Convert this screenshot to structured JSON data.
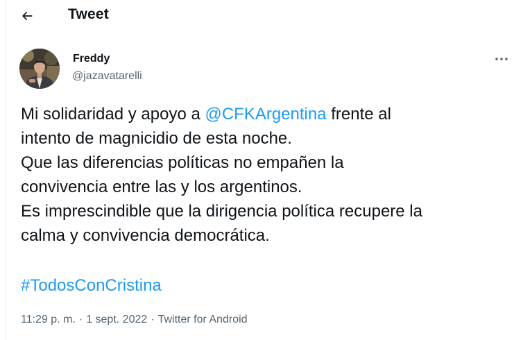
{
  "header": {
    "title": "Tweet",
    "back_icon": "arrow-left-icon"
  },
  "author": {
    "display_name": "Freddy",
    "handle": "@jazavatarelli",
    "avatar_icon": "avatar-photo"
  },
  "more_icon": "more-horizontal-icon",
  "tweet": {
    "line1_pre": "Mi solidaridad y apoyo a ",
    "mention": "@CFKArgentina",
    "line1_post": " frente al",
    "line2": "intento de magnicidio de esta noche.",
    "line3": "Que las diferencias políticas no empañen la",
    "line4": "convivencia entre las y los argentinos.",
    "line5": "Es imprescindible que la dirigencia política recupere la",
    "line6": "calma y convivencia democrática.",
    "hashtag": "#TodosConCristina"
  },
  "meta": {
    "time": "11:29 p. m.",
    "separator": "·",
    "date": "1 sept. 2022",
    "source": "Twitter for Android"
  },
  "colors": {
    "link": "#1d9bf0",
    "text": "#0f1419",
    "secondary": "#536471"
  }
}
